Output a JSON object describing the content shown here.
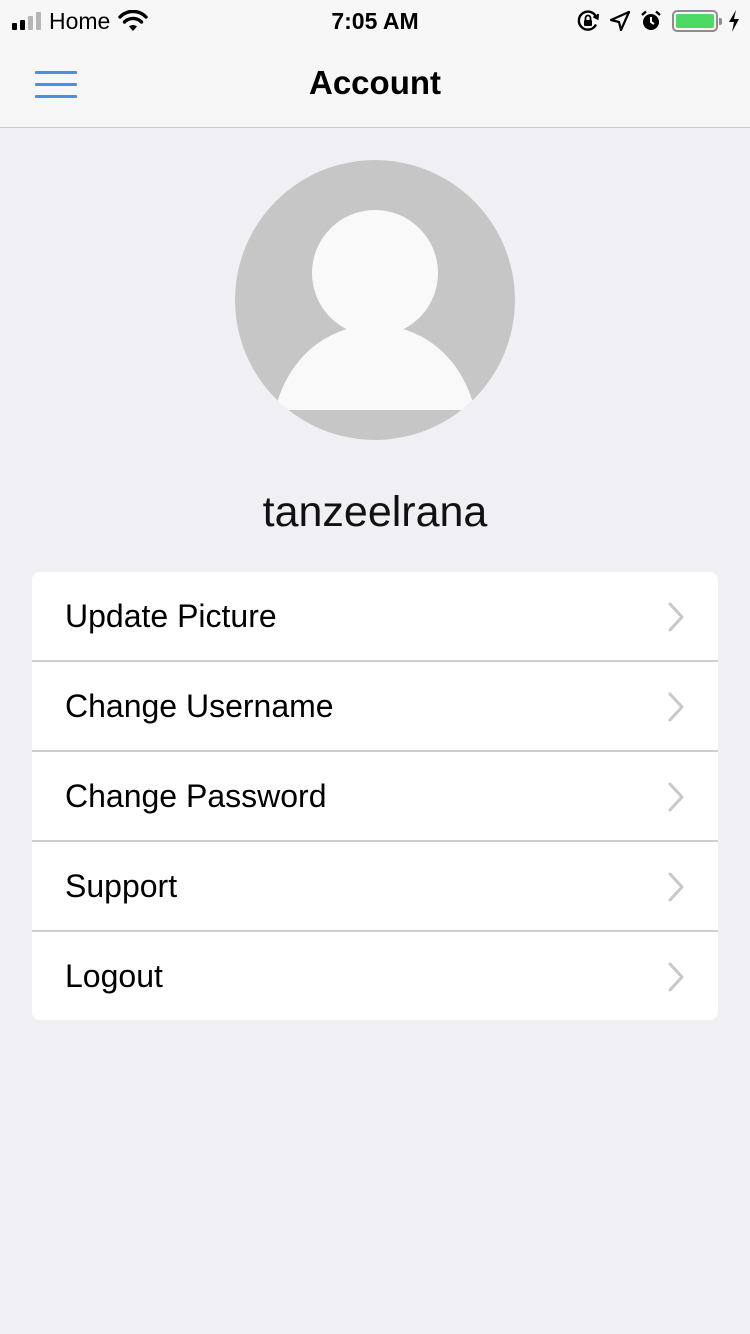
{
  "status_bar": {
    "carrier": "Home",
    "time": "7:05 AM",
    "icons": [
      "signal-icon",
      "wifi-icon",
      "rotation-lock-icon",
      "location-icon",
      "alarm-icon",
      "battery-icon",
      "charging-icon"
    ],
    "battery_color": "#4cd964"
  },
  "nav": {
    "title": "Account",
    "menu_icon": "hamburger-menu-icon",
    "accent_color": "#4a90e2"
  },
  "profile": {
    "username": "tanzeelrana",
    "avatar": "default-avatar-placeholder"
  },
  "menu": {
    "items": [
      {
        "label": "Update Picture"
      },
      {
        "label": "Change Username"
      },
      {
        "label": "Change Password"
      },
      {
        "label": "Support"
      },
      {
        "label": "Logout"
      }
    ],
    "chevron_icon": "chevron-right-icon"
  }
}
